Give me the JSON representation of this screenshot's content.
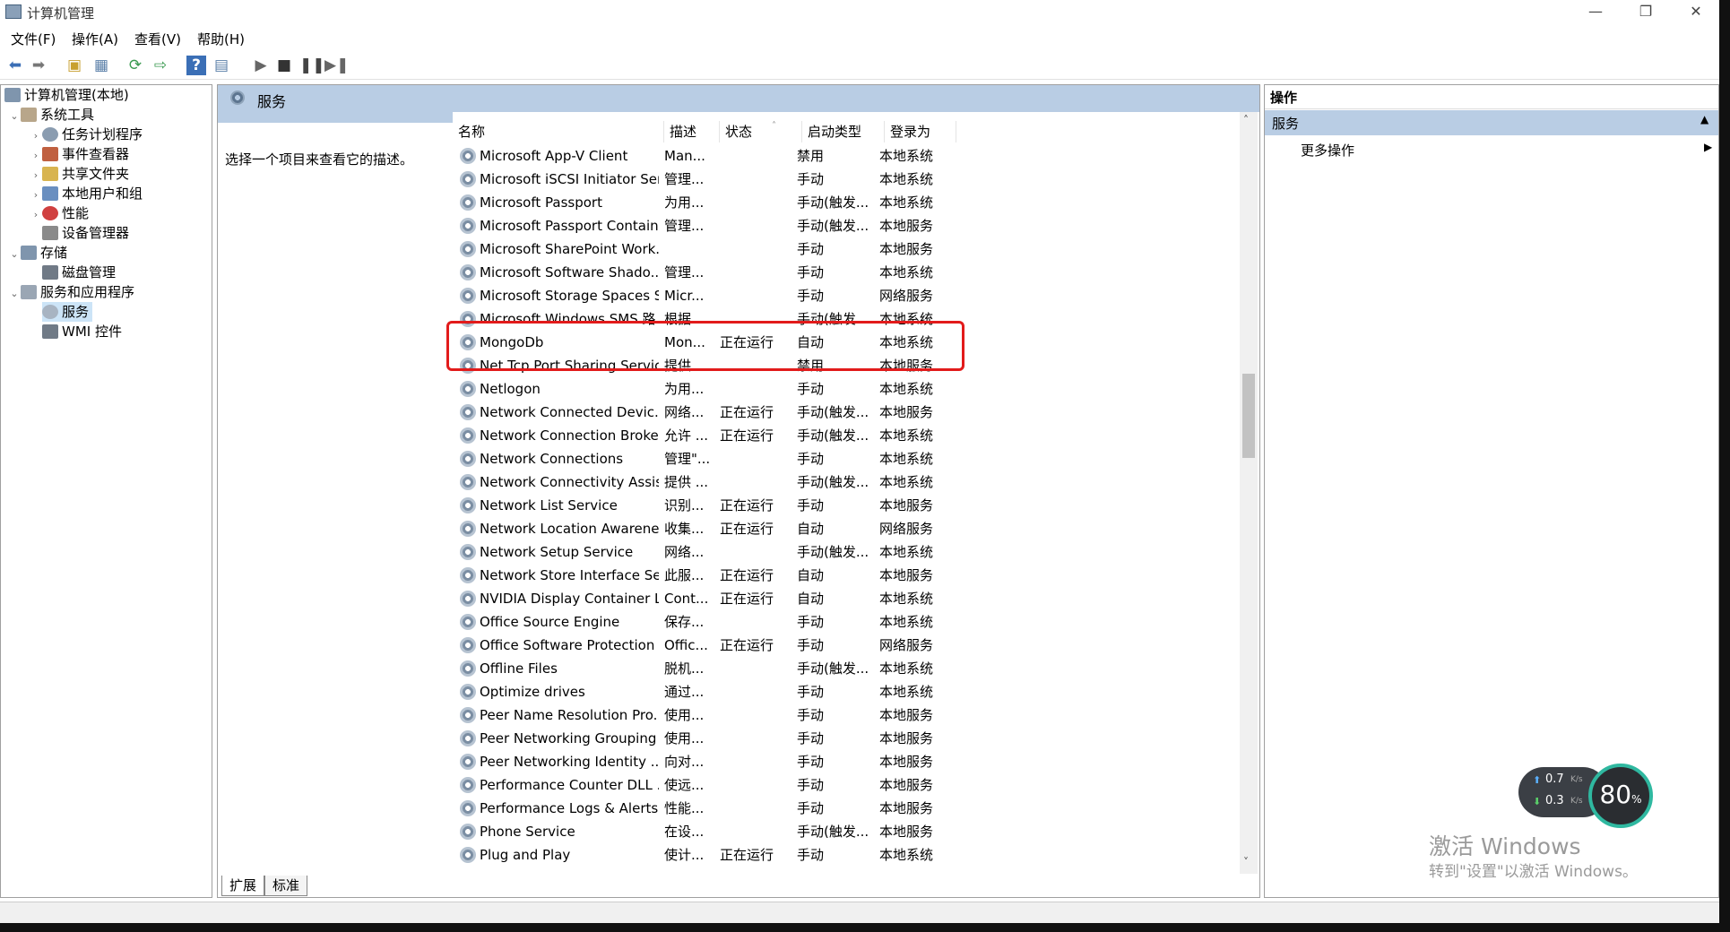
{
  "window": {
    "title": "计算机管理",
    "buttons": [
      "—",
      "❐",
      "✕"
    ]
  },
  "menu": [
    "文件(F)",
    "操作(A)",
    "查看(V)",
    "帮助(H)"
  ],
  "tree": {
    "root": "计算机管理(本地)",
    "system_tools": "系统工具",
    "task_scheduler": "任务计划程序",
    "event_viewer": "事件查看器",
    "shared_folders": "共享文件夹",
    "local_users": "本地用户和组",
    "performance": "性能",
    "device_manager": "设备管理器",
    "storage": "存储",
    "disk_management": "磁盘管理",
    "services_apps": "服务和应用程序",
    "services": "服务",
    "wmi": "WMI 控件"
  },
  "center": {
    "header": "服务",
    "description": "选择一个项目来查看它的描述。",
    "columns": {
      "name": "名称",
      "desc": "描述",
      "status": "状态",
      "startup": "启动类型",
      "logon": "登录为"
    },
    "rows": [
      [
        "Microsoft App-V Client",
        "Man...",
        "",
        "禁用",
        "本地系统"
      ],
      [
        "Microsoft iSCSI Initiator Ser...",
        "管理...",
        "",
        "手动",
        "本地系统"
      ],
      [
        "Microsoft Passport",
        "为用...",
        "",
        "手动(触发...",
        "本地系统"
      ],
      [
        "Microsoft Passport Container",
        "管理...",
        "",
        "手动(触发...",
        "本地服务"
      ],
      [
        "Microsoft SharePoint Work...",
        "",
        "",
        "手动",
        "本地服务"
      ],
      [
        "Microsoft Software Shado...",
        "管理...",
        "",
        "手动",
        "本地系统"
      ],
      [
        "Microsoft Storage Spaces S...",
        "Micr...",
        "",
        "手动",
        "网络服务"
      ],
      [
        "Microsoft Windows SMS 路...",
        "根据...",
        "",
        "手动(触发...",
        "本地系统"
      ],
      [
        "MongoDb",
        "Mon...",
        "正在运行",
        "自动",
        "本地系统"
      ],
      [
        "Net.Tcp Port Sharing Service",
        "提供...",
        "",
        "禁用",
        "本地服务"
      ],
      [
        "Netlogon",
        "为用...",
        "",
        "手动",
        "本地系统"
      ],
      [
        "Network Connected Devic...",
        "网络...",
        "正在运行",
        "手动(触发...",
        "本地服务"
      ],
      [
        "Network Connection Broker",
        "允许 ...",
        "正在运行",
        "手动(触发...",
        "本地系统"
      ],
      [
        "Network Connections",
        "管理\"...",
        "",
        "手动",
        "本地系统"
      ],
      [
        "Network Connectivity Assis...",
        "提供 ...",
        "",
        "手动(触发...",
        "本地系统"
      ],
      [
        "Network List Service",
        "识别...",
        "正在运行",
        "手动",
        "本地服务"
      ],
      [
        "Network Location Awarene...",
        "收集...",
        "正在运行",
        "自动",
        "网络服务"
      ],
      [
        "Network Setup Service",
        "网络...",
        "",
        "手动(触发...",
        "本地系统"
      ],
      [
        "Network Store Interface Se...",
        "此服...",
        "正在运行",
        "自动",
        "本地服务"
      ],
      [
        "NVIDIA Display Container LS",
        "Cont...",
        "正在运行",
        "自动",
        "本地系统"
      ],
      [
        "Office  Source Engine",
        "保存...",
        "",
        "手动",
        "本地系统"
      ],
      [
        "Office Software Protection ...",
        "Offic...",
        "正在运行",
        "手动",
        "网络服务"
      ],
      [
        "Offline Files",
        "脱机...",
        "",
        "手动(触发...",
        "本地系统"
      ],
      [
        "Optimize drives",
        "通过...",
        "",
        "手动",
        "本地系统"
      ],
      [
        "Peer Name Resolution Pro...",
        "使用...",
        "",
        "手动",
        "本地服务"
      ],
      [
        "Peer Networking Grouping",
        "使用...",
        "",
        "手动",
        "本地服务"
      ],
      [
        "Peer Networking Identity ...",
        "向对...",
        "",
        "手动",
        "本地服务"
      ],
      [
        "Performance Counter DLL ...",
        "使远...",
        "",
        "手动",
        "本地服务"
      ],
      [
        "Performance Logs & Alerts",
        "性能...",
        "",
        "手动",
        "本地服务"
      ],
      [
        "Phone Service",
        "在设...",
        "",
        "手动(触发...",
        "本地服务"
      ],
      [
        "Plug and Play",
        "使计...",
        "正在运行",
        "手动",
        "本地系统"
      ]
    ],
    "tabs": [
      "扩展",
      "标准"
    ]
  },
  "actions": {
    "header": "操作",
    "section": "服务",
    "more": "更多操作"
  },
  "speed_widget": {
    "up": "0.7",
    "down": "0.3",
    "unit": "K/s",
    "percent": "80"
  },
  "watermark": {
    "line1": "激活 Windows",
    "line2": "转到\"设置\"以激活 Windows。"
  },
  "accent": "#b9cde4",
  "highlight_color": "#e21b1b"
}
